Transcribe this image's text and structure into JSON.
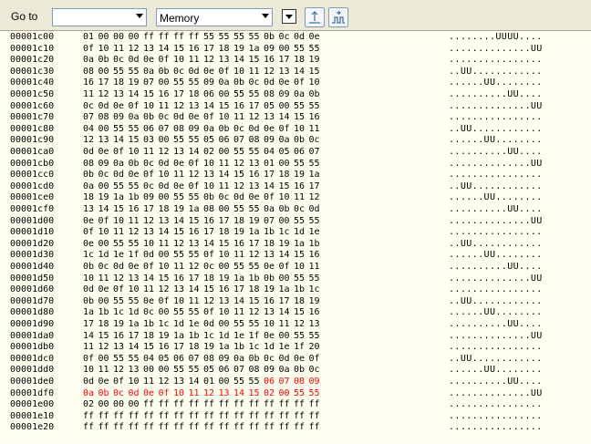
{
  "toolbar": {
    "goto_label": "Go to",
    "goto_value": "",
    "memory_select": "Memory",
    "icons": [
      "dropdown-arrow-icon",
      "single-step-icon",
      "multi-step-icon"
    ]
  },
  "colors": {
    "dump_background": "#fffff0",
    "modified_bytes": "#ff0000",
    "toolbar_background": "#ece9d8"
  },
  "dump": {
    "rows": [
      {
        "addr": "00001c00",
        "bytes": [
          "01",
          "00",
          "00",
          "00",
          "ff",
          "ff",
          "ff",
          "ff",
          "55",
          "55",
          "55",
          "55",
          "0b",
          "0c",
          "0d",
          "0e"
        ],
        "ascii": "........UUUU....",
        "red": []
      },
      {
        "addr": "00001c10",
        "bytes": [
          "0f",
          "10",
          "11",
          "12",
          "13",
          "14",
          "15",
          "16",
          "17",
          "18",
          "19",
          "1a",
          "09",
          "00",
          "55",
          "55"
        ],
        "ascii": "..............UU",
        "red": []
      },
      {
        "addr": "00001c20",
        "bytes": [
          "0a",
          "0b",
          "0c",
          "0d",
          "0e",
          "0f",
          "10",
          "11",
          "12",
          "13",
          "14",
          "15",
          "16",
          "17",
          "18",
          "19"
        ],
        "ascii": "................",
        "red": []
      },
      {
        "addr": "00001c30",
        "bytes": [
          "08",
          "00",
          "55",
          "55",
          "0a",
          "0b",
          "0c",
          "0d",
          "0e",
          "0f",
          "10",
          "11",
          "12",
          "13",
          "14",
          "15"
        ],
        "ascii": "..UU............",
        "red": []
      },
      {
        "addr": "00001c40",
        "bytes": [
          "16",
          "17",
          "18",
          "19",
          "07",
          "00",
          "55",
          "55",
          "09",
          "0a",
          "0b",
          "0c",
          "0d",
          "0e",
          "0f",
          "10"
        ],
        "ascii": "......UU........",
        "red": []
      },
      {
        "addr": "00001c50",
        "bytes": [
          "11",
          "12",
          "13",
          "14",
          "15",
          "16",
          "17",
          "18",
          "06",
          "00",
          "55",
          "55",
          "08",
          "09",
          "0a",
          "0b"
        ],
        "ascii": "..........UU....",
        "red": []
      },
      {
        "addr": "00001c60",
        "bytes": [
          "0c",
          "0d",
          "0e",
          "0f",
          "10",
          "11",
          "12",
          "13",
          "14",
          "15",
          "16",
          "17",
          "05",
          "00",
          "55",
          "55"
        ],
        "ascii": "..............UU",
        "red": []
      },
      {
        "addr": "00001c70",
        "bytes": [
          "07",
          "08",
          "09",
          "0a",
          "0b",
          "0c",
          "0d",
          "0e",
          "0f",
          "10",
          "11",
          "12",
          "13",
          "14",
          "15",
          "16"
        ],
        "ascii": "................",
        "red": []
      },
      {
        "addr": "00001c80",
        "bytes": [
          "04",
          "00",
          "55",
          "55",
          "06",
          "07",
          "08",
          "09",
          "0a",
          "0b",
          "0c",
          "0d",
          "0e",
          "0f",
          "10",
          "11"
        ],
        "ascii": "..UU............",
        "red": []
      },
      {
        "addr": "00001c90",
        "bytes": [
          "12",
          "13",
          "14",
          "15",
          "03",
          "00",
          "55",
          "55",
          "05",
          "06",
          "07",
          "08",
          "09",
          "0a",
          "0b",
          "0c"
        ],
        "ascii": "......UU........",
        "red": []
      },
      {
        "addr": "00001ca0",
        "bytes": [
          "0d",
          "0e",
          "0f",
          "10",
          "11",
          "12",
          "13",
          "14",
          "02",
          "00",
          "55",
          "55",
          "04",
          "05",
          "06",
          "07"
        ],
        "ascii": "..........UU....",
        "red": []
      },
      {
        "addr": "00001cb0",
        "bytes": [
          "08",
          "09",
          "0a",
          "0b",
          "0c",
          "0d",
          "0e",
          "0f",
          "10",
          "11",
          "12",
          "13",
          "01",
          "00",
          "55",
          "55"
        ],
        "ascii": "..............UU",
        "red": []
      },
      {
        "addr": "00001cc0",
        "bytes": [
          "0b",
          "0c",
          "0d",
          "0e",
          "0f",
          "10",
          "11",
          "12",
          "13",
          "14",
          "15",
          "16",
          "17",
          "18",
          "19",
          "1a"
        ],
        "ascii": "................",
        "red": []
      },
      {
        "addr": "00001cd0",
        "bytes": [
          "0a",
          "00",
          "55",
          "55",
          "0c",
          "0d",
          "0e",
          "0f",
          "10",
          "11",
          "12",
          "13",
          "14",
          "15",
          "16",
          "17"
        ],
        "ascii": "..UU............",
        "red": []
      },
      {
        "addr": "00001ce0",
        "bytes": [
          "18",
          "19",
          "1a",
          "1b",
          "09",
          "00",
          "55",
          "55",
          "0b",
          "0c",
          "0d",
          "0e",
          "0f",
          "10",
          "11",
          "12"
        ],
        "ascii": "......UU........",
        "red": []
      },
      {
        "addr": "00001cf0",
        "bytes": [
          "13",
          "14",
          "15",
          "16",
          "17",
          "18",
          "19",
          "1a",
          "08",
          "00",
          "55",
          "55",
          "0a",
          "0b",
          "0c",
          "0d"
        ],
        "ascii": "..........UU....",
        "red": []
      },
      {
        "addr": "00001d00",
        "bytes": [
          "0e",
          "0f",
          "10",
          "11",
          "12",
          "13",
          "14",
          "15",
          "16",
          "17",
          "18",
          "19",
          "07",
          "00",
          "55",
          "55"
        ],
        "ascii": "..............UU",
        "red": []
      },
      {
        "addr": "00001d10",
        "bytes": [
          "0f",
          "10",
          "11",
          "12",
          "13",
          "14",
          "15",
          "16",
          "17",
          "18",
          "19",
          "1a",
          "1b",
          "1c",
          "1d",
          "1e"
        ],
        "ascii": "................",
        "red": []
      },
      {
        "addr": "00001d20",
        "bytes": [
          "0e",
          "00",
          "55",
          "55",
          "10",
          "11",
          "12",
          "13",
          "14",
          "15",
          "16",
          "17",
          "18",
          "19",
          "1a",
          "1b"
        ],
        "ascii": "..UU............",
        "red": []
      },
      {
        "addr": "00001d30",
        "bytes": [
          "1c",
          "1d",
          "1e",
          "1f",
          "0d",
          "00",
          "55",
          "55",
          "0f",
          "10",
          "11",
          "12",
          "13",
          "14",
          "15",
          "16"
        ],
        "ascii": "......UU........",
        "red": []
      },
      {
        "addr": "00001d40",
        "bytes": [
          "0b",
          "0c",
          "0d",
          "0e",
          "0f",
          "10",
          "11",
          "12",
          "0c",
          "00",
          "55",
          "55",
          "0e",
          "0f",
          "10",
          "11"
        ],
        "ascii": "..........UU....",
        "red": []
      },
      {
        "addr": "00001d50",
        "bytes": [
          "10",
          "11",
          "12",
          "13",
          "14",
          "15",
          "16",
          "17",
          "18",
          "19",
          "1a",
          "1b",
          "0b",
          "00",
          "55",
          "55"
        ],
        "ascii": "..............UU",
        "red": []
      },
      {
        "addr": "00001d60",
        "bytes": [
          "0d",
          "0e",
          "0f",
          "10",
          "11",
          "12",
          "13",
          "14",
          "15",
          "16",
          "17",
          "18",
          "19",
          "1a",
          "1b",
          "1c"
        ],
        "ascii": "................",
        "red": []
      },
      {
        "addr": "00001d70",
        "bytes": [
          "0b",
          "00",
          "55",
          "55",
          "0e",
          "0f",
          "10",
          "11",
          "12",
          "13",
          "14",
          "15",
          "16",
          "17",
          "18",
          "19"
        ],
        "ascii": "..UU............",
        "red": []
      },
      {
        "addr": "00001d80",
        "bytes": [
          "1a",
          "1b",
          "1c",
          "1d",
          "0c",
          "00",
          "55",
          "55",
          "0f",
          "10",
          "11",
          "12",
          "13",
          "14",
          "15",
          "16"
        ],
        "ascii": "......UU........",
        "red": []
      },
      {
        "addr": "00001d90",
        "bytes": [
          "17",
          "18",
          "19",
          "1a",
          "1b",
          "1c",
          "1d",
          "1e",
          "0d",
          "00",
          "55",
          "55",
          "10",
          "11",
          "12",
          "13"
        ],
        "ascii": "..........UU....",
        "red": []
      },
      {
        "addr": "00001da0",
        "bytes": [
          "14",
          "15",
          "16",
          "17",
          "18",
          "19",
          "1a",
          "1b",
          "1c",
          "1d",
          "1e",
          "1f",
          "0e",
          "00",
          "55",
          "55"
        ],
        "ascii": "..............UU",
        "red": []
      },
      {
        "addr": "00001db0",
        "bytes": [
          "11",
          "12",
          "13",
          "14",
          "15",
          "16",
          "17",
          "18",
          "19",
          "1a",
          "1b",
          "1c",
          "1d",
          "1e",
          "1f",
          "20"
        ],
        "ascii": "................",
        "red": []
      },
      {
        "addr": "00001dc0",
        "bytes": [
          "0f",
          "00",
          "55",
          "55",
          "04",
          "05",
          "06",
          "07",
          "08",
          "09",
          "0a",
          "0b",
          "0c",
          "0d",
          "0e",
          "0f"
        ],
        "ascii": "..UU............",
        "red": []
      },
      {
        "addr": "00001dd0",
        "bytes": [
          "10",
          "11",
          "12",
          "13",
          "00",
          "00",
          "55",
          "55",
          "05",
          "06",
          "07",
          "08",
          "09",
          "0a",
          "0b",
          "0c"
        ],
        "ascii": "......UU........",
        "red": []
      },
      {
        "addr": "00001de0",
        "bytes": [
          "0d",
          "0e",
          "0f",
          "10",
          "11",
          "12",
          "13",
          "14",
          "01",
          "00",
          "55",
          "55",
          "06",
          "07",
          "08",
          "09"
        ],
        "ascii": "..........UU....",
        "red": [
          12,
          13,
          14,
          15
        ]
      },
      {
        "addr": "00001df0",
        "bytes": [
          "0a",
          "0b",
          "0c",
          "0d",
          "0e",
          "0f",
          "10",
          "11",
          "12",
          "13",
          "14",
          "15",
          "02",
          "00",
          "55",
          "55"
        ],
        "ascii": "..............UU",
        "red": [
          0,
          1,
          2,
          3,
          4,
          5,
          6,
          7,
          8,
          9,
          10,
          11,
          12,
          13,
          14,
          15
        ]
      },
      {
        "addr": "00001e00",
        "bytes": [
          "02",
          "00",
          "00",
          "00",
          "ff",
          "ff",
          "ff",
          "ff",
          "ff",
          "ff",
          "ff",
          "ff",
          "ff",
          "ff",
          "ff",
          "ff"
        ],
        "ascii": "................",
        "red": []
      },
      {
        "addr": "00001e10",
        "bytes": [
          "ff",
          "ff",
          "ff",
          "ff",
          "ff",
          "ff",
          "ff",
          "ff",
          "ff",
          "ff",
          "ff",
          "ff",
          "ff",
          "ff",
          "ff",
          "ff"
        ],
        "ascii": "................",
        "red": []
      },
      {
        "addr": "00001e20",
        "bytes": [
          "ff",
          "ff",
          "ff",
          "ff",
          "ff",
          "ff",
          "ff",
          "ff",
          "ff",
          "ff",
          "ff",
          "ff",
          "ff",
          "ff",
          "ff",
          "ff"
        ],
        "ascii": "................",
        "red": []
      }
    ]
  }
}
